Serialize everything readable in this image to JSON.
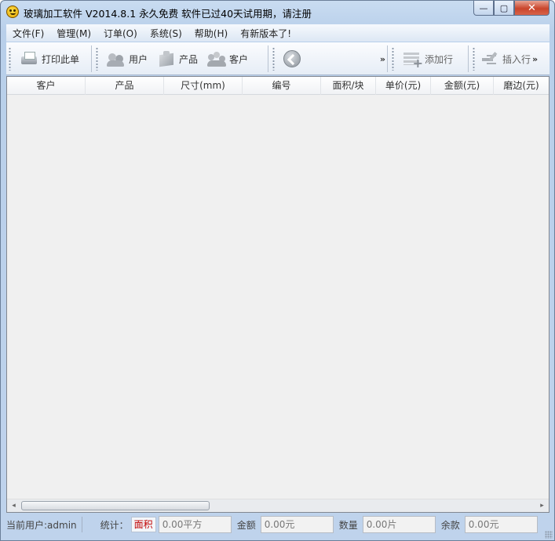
{
  "window": {
    "title": "玻璃加工软件 V2014.8.1  永久免费   软件已过40天试用期，请注册",
    "minimize_symbol": "—",
    "maximize_symbol": "▢",
    "close_symbol": "✕"
  },
  "menu": [
    {
      "label": "文件(F)"
    },
    {
      "label": "管理(M)"
    },
    {
      "label": "订单(O)"
    },
    {
      "label": "系统(S)"
    },
    {
      "label": "帮助(H)"
    },
    {
      "label": "有新版本了!"
    }
  ],
  "toolbar": {
    "print_label": "打印此单",
    "user_label": "用户",
    "product_label": "产品",
    "customer_label": "客户",
    "add_row_label": "添加行",
    "insert_row_label": "插入行",
    "overflow_symbol": "»",
    "icons": [
      "printer-icon",
      "users-icon",
      "box-icon",
      "people-icon",
      "back-arrow-icon",
      "add-row-icon",
      "insert-row-icon"
    ]
  },
  "grid": {
    "columns": [
      "客户",
      "产品",
      "尺寸(mm)",
      "编号",
      "面积/块",
      "单价(元)",
      "金额(元)",
      "磨边(元)"
    ],
    "rows": []
  },
  "scrollbar": {
    "left_arrow": "◂",
    "right_arrow": "▸"
  },
  "status": {
    "current_user": "当前用户:admin",
    "stats_label": "统计：",
    "area_label": "面积",
    "area_value": "0.00平方",
    "amount_label": "金额",
    "amount_value": "0.00元",
    "quantity_label": "数量",
    "quantity_value": "0.00片",
    "balance_label": "余款",
    "balance_value": "0.00元"
  },
  "colors": {
    "area_label": "#c00000",
    "close_button": "#c9452b",
    "frame": "#bfd3ec"
  }
}
